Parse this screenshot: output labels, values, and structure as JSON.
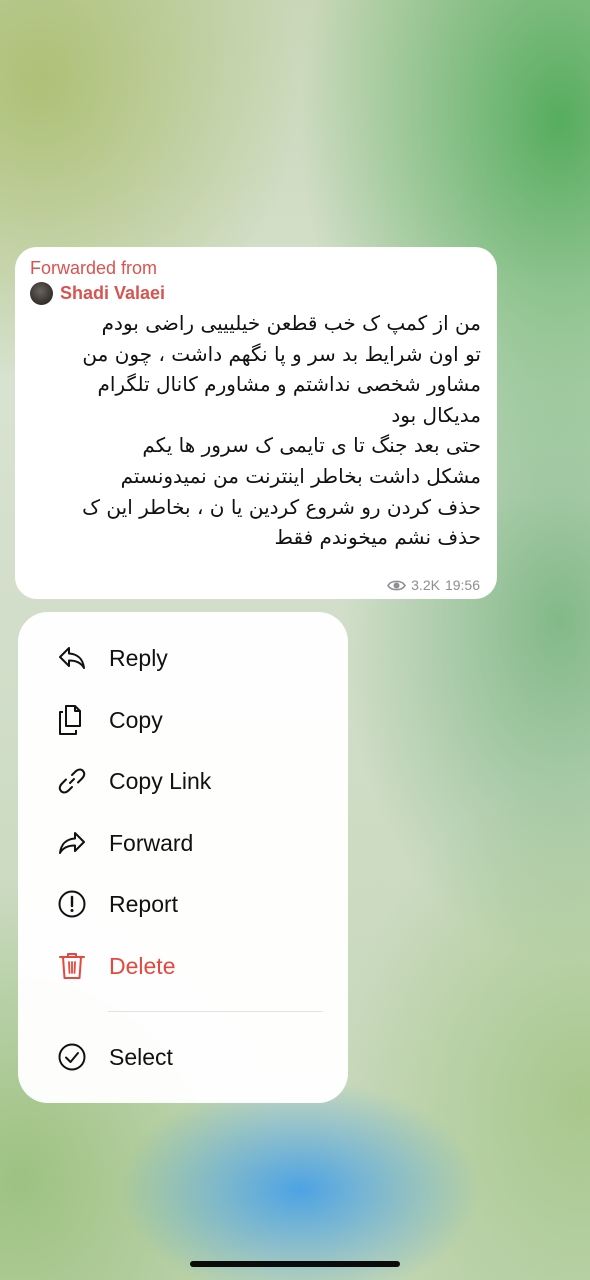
{
  "message": {
    "forwarded_label": "Forwarded from",
    "forwarded_name": "Shadi Valaei",
    "text": "من از کمپ ک خب قطعن خیلیییی راضی بودم\nتو اون شرایط بد سر و پا نگهم داشت ، چون من\nمشاور شخصی نداشتم و مشاورم کانال تلگرام\nمدیکال بود\nحتی بعد جنگ تا ی تایمی ک سرور ها یکم\nمشکل داشت بخاطر اینترنت من نمیدونستم\nحذف کردن رو شروع کردین یا ن ، بخاطر این ک\nحذف نشم میخوندم فقط",
    "views": "3.2K",
    "time": "19:56",
    "views_icon": "eye-icon"
  },
  "menu": {
    "items": [
      {
        "label": "Reply",
        "icon": "reply-icon"
      },
      {
        "label": "Copy",
        "icon": "copy-icon"
      },
      {
        "label": "Copy Link",
        "icon": "link-icon"
      },
      {
        "label": "Forward",
        "icon": "forward-icon"
      },
      {
        "label": "Report",
        "icon": "report-icon"
      },
      {
        "label": "Delete",
        "icon": "trash-icon"
      },
      {
        "label": "Select",
        "icon": "select-check-icon"
      }
    ]
  },
  "colors": {
    "accent_red": "#d9534f",
    "destructive": "#e5483f",
    "meta_gray": "#8e8e93"
  }
}
